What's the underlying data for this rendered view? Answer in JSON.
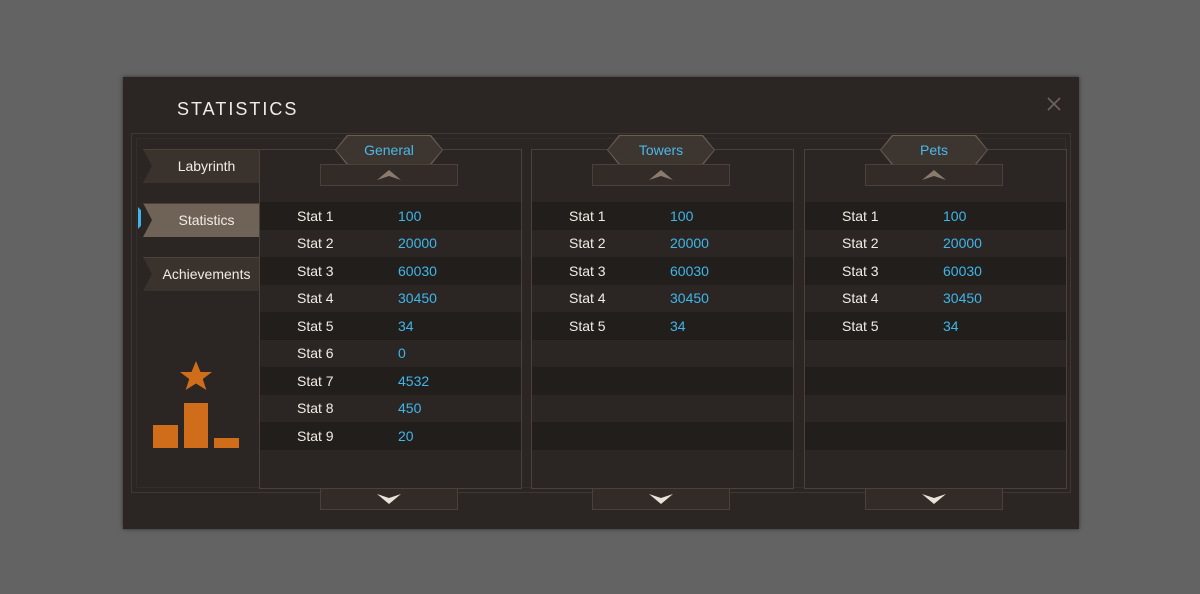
{
  "window": {
    "title": "STATISTICS"
  },
  "nav": {
    "items": [
      {
        "label": "Labyrinth",
        "active": false
      },
      {
        "label": "Statistics",
        "active": true
      },
      {
        "label": "Achievements",
        "active": false
      }
    ]
  },
  "columns": [
    {
      "header": "General",
      "stats": [
        {
          "label": "Stat 1",
          "value": "100"
        },
        {
          "label": "Stat 2",
          "value": "20000"
        },
        {
          "label": "Stat 3",
          "value": "60030"
        },
        {
          "label": "Stat 4",
          "value": "30450"
        },
        {
          "label": "Stat 5",
          "value": "34"
        },
        {
          "label": "Stat 6",
          "value": "0"
        },
        {
          "label": "Stat 7",
          "value": "4532"
        },
        {
          "label": "Stat 8",
          "value": "450"
        },
        {
          "label": "Stat 9",
          "value": "20"
        }
      ]
    },
    {
      "header": "Towers",
      "stats": [
        {
          "label": "Stat 1",
          "value": "100"
        },
        {
          "label": "Stat 2",
          "value": "20000"
        },
        {
          "label": "Stat 3",
          "value": "60030"
        },
        {
          "label": "Stat 4",
          "value": "30450"
        },
        {
          "label": "Stat 5",
          "value": "34"
        }
      ]
    },
    {
      "header": "Pets",
      "stats": [
        {
          "label": "Stat 1",
          "value": "100"
        },
        {
          "label": "Stat 2",
          "value": "20000"
        },
        {
          "label": "Stat 3",
          "value": "60030"
        },
        {
          "label": "Stat 4",
          "value": "30450"
        },
        {
          "label": "Stat 5",
          "value": "34"
        }
      ]
    }
  ],
  "icons": {
    "close": "close-icon",
    "scroll_up": "chevron-up-icon",
    "scroll_down": "chevron-down-icon",
    "trophy": "podium-star-icon",
    "nav_marker": "triangle-right-icon"
  },
  "colors": {
    "background": "#636363",
    "window": "#2b2624",
    "accent_blue": "#3fb6ea",
    "trophy_orange": "#d06d1a",
    "text": "#f1ece4"
  }
}
